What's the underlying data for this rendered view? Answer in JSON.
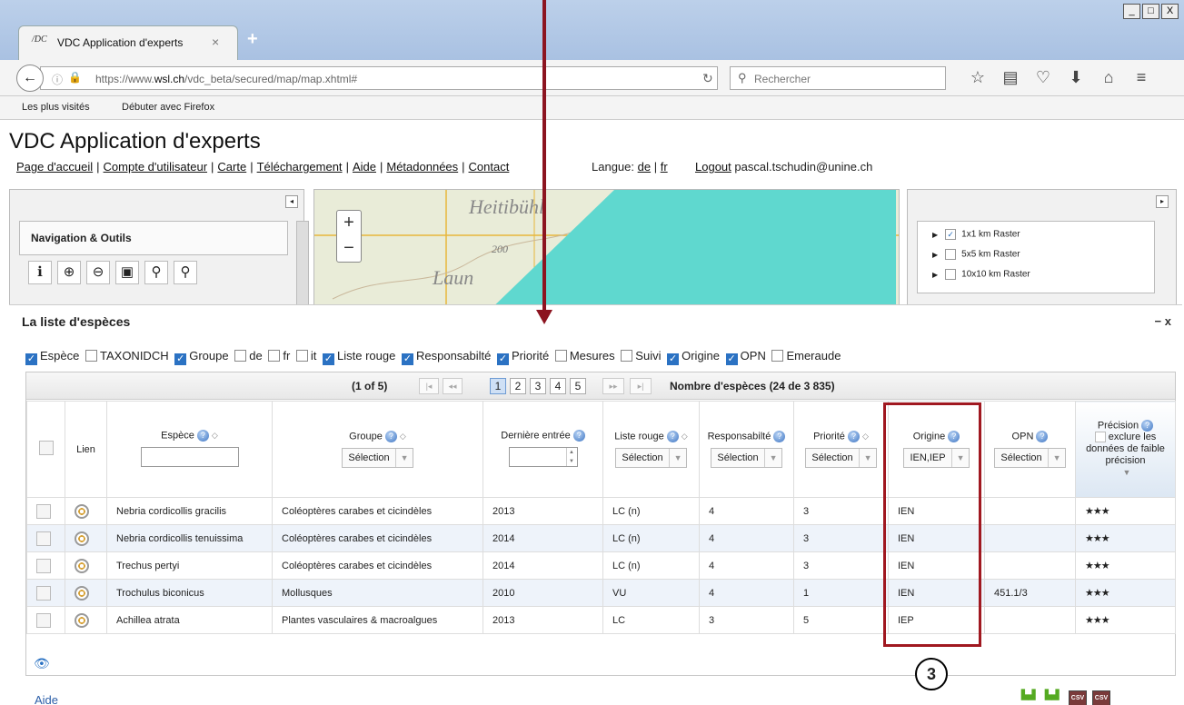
{
  "browser": {
    "tab_icon_text": "/DC",
    "tab_title": "VDC Application d'experts",
    "tab_close": "×",
    "new_tab": "+",
    "window_buttons": [
      "_",
      "□",
      "X"
    ],
    "url_prefix": "https://www.",
    "url_domain": "wsl.ch",
    "url_suffix": "/vdc_beta/secured/map/map.xhtml#",
    "search_placeholder": "Rechercher",
    "bookmarks": [
      "Les plus visités",
      "Débuter avec Firefox"
    ]
  },
  "app": {
    "title": "VDC Application d'experts",
    "nav": [
      "Page d'accueil",
      "Compte d'utilisateur",
      "Carte",
      "Téléchargement",
      "Aide",
      "Métadonnées",
      "Contact"
    ],
    "lang_label": "Langue:",
    "lang_de": "de",
    "lang_fr": "fr",
    "logout_label": "Logout",
    "user": "pascal.tschudin@unine.ch"
  },
  "left_panel": {
    "nav_tools_title": "Navigation & Outils"
  },
  "map": {
    "place1": "Heitibühl",
    "place2": "200",
    "place3": "Laun",
    "zoom_in": "+",
    "zoom_out": "−"
  },
  "layers": [
    "1x1 km Raster",
    "5x5 km Raster",
    "10x10 km Raster"
  ],
  "dialog": {
    "title": "La liste d'espèces",
    "minimize": "−",
    "close": "x",
    "columns": [
      {
        "label": "Espèce",
        "checked": true
      },
      {
        "label": "TAXONIDCH",
        "checked": false
      },
      {
        "label": "Groupe",
        "checked": true
      },
      {
        "label": "de",
        "checked": false
      },
      {
        "label": "fr",
        "checked": false
      },
      {
        "label": "it",
        "checked": false
      },
      {
        "label": "Liste rouge",
        "checked": true
      },
      {
        "label": "Responsabilté",
        "checked": true
      },
      {
        "label": "Priorité",
        "checked": true
      },
      {
        "label": "Mesures",
        "checked": false
      },
      {
        "label": "Suivi",
        "checked": false
      },
      {
        "label": "Origine",
        "checked": true
      },
      {
        "label": "OPN",
        "checked": true
      },
      {
        "label": "Emeraude",
        "checked": false
      }
    ],
    "pager_current": "(1 of 5)",
    "pages": [
      "1",
      "2",
      "3",
      "4",
      "5"
    ],
    "species_count": "Nombre d'espèces (24 de 3 835)",
    "headers": {
      "lien": "Lien",
      "espece": "Espèce",
      "groupe": "Groupe",
      "derniere": "Dernière entrée",
      "liste_rouge": "Liste rouge",
      "responsabilite": "Responsabilté",
      "priorite": "Priorité",
      "origine": "Origine",
      "opn": "OPN",
      "precision": "Précision",
      "precision_note": "exclure les données de faible précision"
    },
    "filters": {
      "groupe": "Sélection",
      "liste_rouge": "Sélection",
      "responsabilite": "Sélection",
      "priorite": "Sélection",
      "origine": "IEN,IEP",
      "opn": "Sélection"
    },
    "rows": [
      {
        "espece": "Nebria cordicollis gracilis",
        "groupe": "Coléoptères carabes et cicindèles",
        "derniere": "2013",
        "liste_rouge": "LC (n)",
        "responsabilite": "4",
        "priorite": "3",
        "origine": "IEN",
        "opn": "",
        "precision": "★★★"
      },
      {
        "espece": "Nebria cordicollis tenuissima",
        "groupe": "Coléoptères carabes et cicindèles",
        "derniere": "2014",
        "liste_rouge": "LC (n)",
        "responsabilite": "4",
        "priorite": "3",
        "origine": "IEN",
        "opn": "",
        "precision": "★★★"
      },
      {
        "espece": "Trechus pertyi",
        "groupe": "Coléoptères carabes et cicindèles",
        "derniere": "2014",
        "liste_rouge": "LC (n)",
        "responsabilite": "4",
        "priorite": "3",
        "origine": "IEN",
        "opn": "",
        "precision": "★★★"
      },
      {
        "espece": "Trochulus biconicus",
        "groupe": "Mollusques",
        "derniere": "2010",
        "liste_rouge": "VU",
        "responsabilite": "4",
        "priorite": "1",
        "origine": "IEN",
        "opn": "451.1/3",
        "precision": "★★★"
      },
      {
        "espece": "Achillea atrata",
        "groupe": "Plantes vasculaires & macroalgues",
        "derniere": "2013",
        "liste_rouge": "LC",
        "responsabilite": "3",
        "priorite": "5",
        "origine": "IEP",
        "opn": "",
        "precision": "★★★"
      }
    ],
    "aide": "Aide"
  },
  "annotation": {
    "callout": "3",
    "color": "#a01820"
  }
}
